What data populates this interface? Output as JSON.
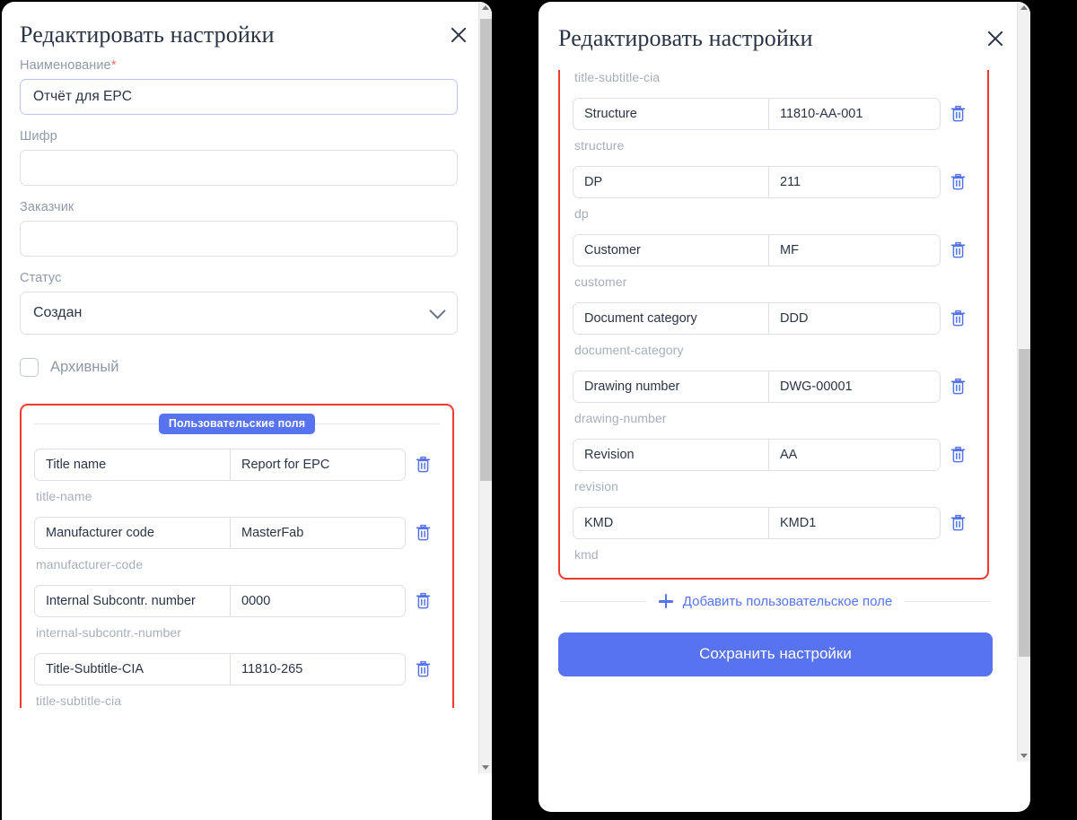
{
  "left_dialog": {
    "title": "Редактировать настройки",
    "close_icon": "close-icon",
    "fields": {
      "name": {
        "label": "Наименование",
        "required_mark": "*",
        "value": "Отчёт для EPC",
        "placeholder": ""
      },
      "code": {
        "label": "Шифр",
        "value": "",
        "placeholder": ""
      },
      "customer": {
        "label": "Заказчик",
        "value": "",
        "placeholder": ""
      },
      "status": {
        "label": "Статус",
        "value": "Создан",
        "chevron_icon": "chevron-down-icon"
      }
    },
    "archive_checkbox": {
      "label": "Архивный",
      "checked": false
    },
    "section_badge": "Пользовательские поля",
    "custom_fields": [
      {
        "key": "Title name",
        "value": "Report for EPC",
        "slug": "title-name",
        "delete_icon": "trash-icon"
      },
      {
        "key": "Manufacturer code",
        "value": "MasterFab",
        "slug": "manufacturer-code",
        "delete_icon": "trash-icon"
      },
      {
        "key": "Internal Subcontr. number",
        "value": "0000",
        "slug": "internal-subcontr.-number",
        "delete_icon": "trash-icon"
      },
      {
        "key": "Title-Subtitle-CIA",
        "value": "11810-265",
        "slug": "title-subtitle-cia",
        "delete_icon": "trash-icon"
      }
    ],
    "scrollbar": {
      "up_icon": "scroll-up-arrow-icon",
      "down_icon": "scroll-down-arrow-icon"
    }
  },
  "right_dialog": {
    "title": "Редактировать настройки",
    "close_icon": "close-icon",
    "top_slug": "title-subtitle-cia",
    "custom_fields": [
      {
        "key": "Structure",
        "value": "11810-AA-001",
        "slug": "structure",
        "delete_icon": "trash-icon"
      },
      {
        "key": "DP",
        "value": "211",
        "slug": "dp",
        "delete_icon": "trash-icon"
      },
      {
        "key": "Customer",
        "value": "MF",
        "slug": "customer",
        "delete_icon": "trash-icon"
      },
      {
        "key": "Document category",
        "value": "DDD",
        "slug": "document-category",
        "delete_icon": "trash-icon"
      },
      {
        "key": "Drawing number",
        "value": "DWG-00001",
        "slug": "drawing-number",
        "delete_icon": "trash-icon"
      },
      {
        "key": "Revision",
        "value": "AA",
        "slug": "revision",
        "delete_icon": "trash-icon"
      },
      {
        "key": "KMD",
        "value": "KMD1",
        "slug": "kmd",
        "delete_icon": "trash-icon"
      }
    ],
    "add_field_link": {
      "label": "Добавить пользовательское поле",
      "icon": "plus-icon"
    },
    "save_button": "Сохранить настройки",
    "scrollbar": {
      "up_icon": "scroll-up-arrow-icon",
      "down_icon": "scroll-down-arrow-icon"
    }
  },
  "colors": {
    "accent_blue": "#5773f0",
    "highlight_red": "#f03a2e",
    "title_text": "#2b3445",
    "muted_text": "#9199a8",
    "border": "#dcdfe5",
    "required_star": "#f0706e",
    "background": "#000000"
  }
}
